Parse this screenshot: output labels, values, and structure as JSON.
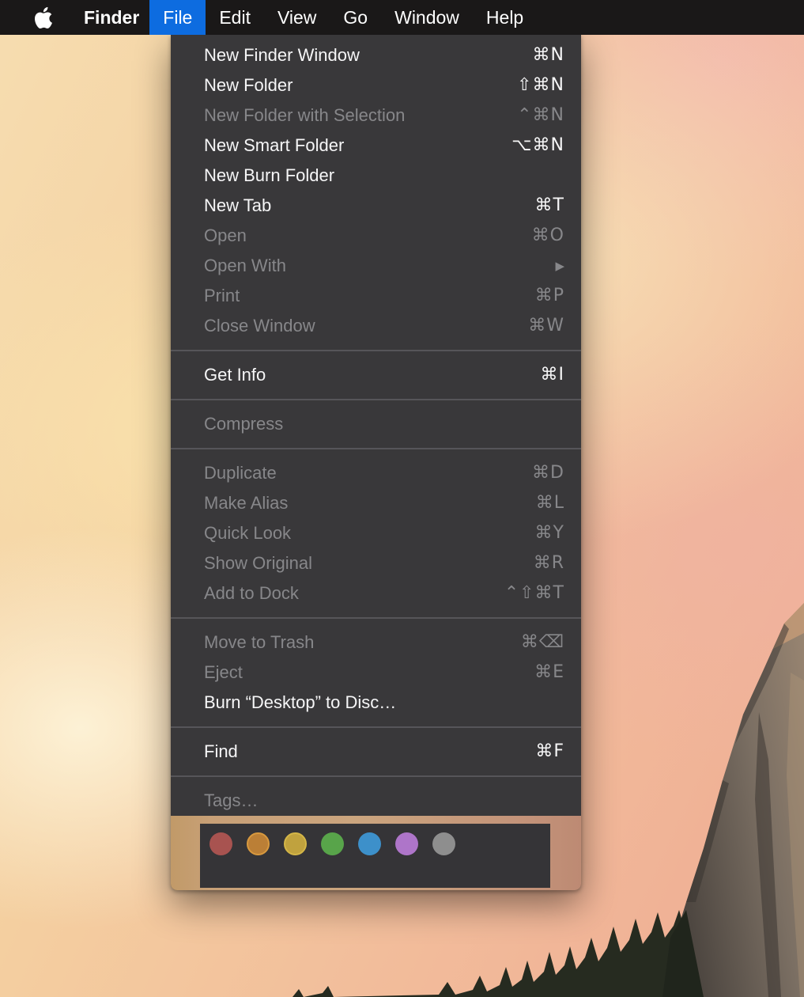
{
  "menu_bar": {
    "apple_icon": "apple-logo",
    "items": [
      {
        "label": "Finder",
        "bold": true,
        "highlighted": false
      },
      {
        "label": "File",
        "bold": false,
        "highlighted": true
      },
      {
        "label": "Edit",
        "bold": false,
        "highlighted": false
      },
      {
        "label": "View",
        "bold": false,
        "highlighted": false
      },
      {
        "label": "Go",
        "bold": false,
        "highlighted": false
      },
      {
        "label": "Window",
        "bold": false,
        "highlighted": false
      },
      {
        "label": "Help",
        "bold": false,
        "highlighted": false
      }
    ],
    "colors": {
      "bar_bg": "#1a1818",
      "highlight": "#0d6ce0",
      "text": "#ffffff"
    }
  },
  "file_menu": {
    "sections": [
      {
        "items": [
          {
            "label": "New Finder Window",
            "shortcut": "⌘N",
            "enabled": true
          },
          {
            "label": "New Folder",
            "shortcut": "⇧⌘N",
            "enabled": true
          },
          {
            "label": "New Folder with Selection",
            "shortcut": "⌃⌘N",
            "enabled": false
          },
          {
            "label": "New Smart Folder",
            "shortcut": "⌥⌘N",
            "enabled": true
          },
          {
            "label": "New Burn Folder",
            "shortcut": "",
            "enabled": true
          },
          {
            "label": "New Tab",
            "shortcut": "⌘T",
            "enabled": true
          },
          {
            "label": "Open",
            "shortcut": "⌘O",
            "enabled": false
          },
          {
            "label": "Open With",
            "shortcut": "▶",
            "enabled": false,
            "submenu": true
          },
          {
            "label": "Print",
            "shortcut": "⌘P",
            "enabled": false
          },
          {
            "label": "Close Window",
            "shortcut": "⌘W",
            "enabled": false
          }
        ]
      },
      {
        "items": [
          {
            "label": "Get Info",
            "shortcut": "⌘I",
            "enabled": true
          }
        ]
      },
      {
        "items": [
          {
            "label": "Compress",
            "shortcut": "",
            "enabled": false
          }
        ]
      },
      {
        "items": [
          {
            "label": "Duplicate",
            "shortcut": "⌘D",
            "enabled": false
          },
          {
            "label": "Make Alias",
            "shortcut": "⌘L",
            "enabled": false
          },
          {
            "label": "Quick Look",
            "shortcut": "⌘Y",
            "enabled": false
          },
          {
            "label": "Show Original",
            "shortcut": "⌘R",
            "enabled": false
          },
          {
            "label": "Add to Dock",
            "shortcut": "⌃⇧⌘T",
            "enabled": false
          }
        ]
      },
      {
        "items": [
          {
            "label": "Move to Trash",
            "shortcut": "⌘⌫",
            "enabled": false
          },
          {
            "label": "Eject",
            "shortcut": "⌘E",
            "enabled": false
          },
          {
            "label": "Burn “Desktop” to Disc…",
            "shortcut": "",
            "enabled": true
          }
        ]
      },
      {
        "items": [
          {
            "label": "Find",
            "shortcut": "⌘F",
            "enabled": true
          }
        ]
      },
      {
        "items": [
          {
            "label": "Tags…",
            "shortcut": "",
            "enabled": false
          }
        ]
      }
    ],
    "tags": [
      {
        "name": "red",
        "color": "#a85350"
      },
      {
        "name": "orange",
        "color": "#bb7f36",
        "ring": "#d8993e"
      },
      {
        "name": "yellow",
        "color": "#c0a23e",
        "ring": "#d4b647"
      },
      {
        "name": "green",
        "color": "#58a44a"
      },
      {
        "name": "blue",
        "color": "#3d90ca"
      },
      {
        "name": "purple",
        "color": "#ae75c9"
      },
      {
        "name": "gray",
        "color": "#8e8e8e"
      }
    ],
    "colors": {
      "panel_bg": "#39383a",
      "separator": "#565559",
      "enabled_text": "#f6f6f7",
      "disabled_text": "#87878a",
      "tag_strip_left": "#c19a68",
      "tag_strip_right": "#bd8a73",
      "tag_inner_bg": "#353437"
    }
  }
}
